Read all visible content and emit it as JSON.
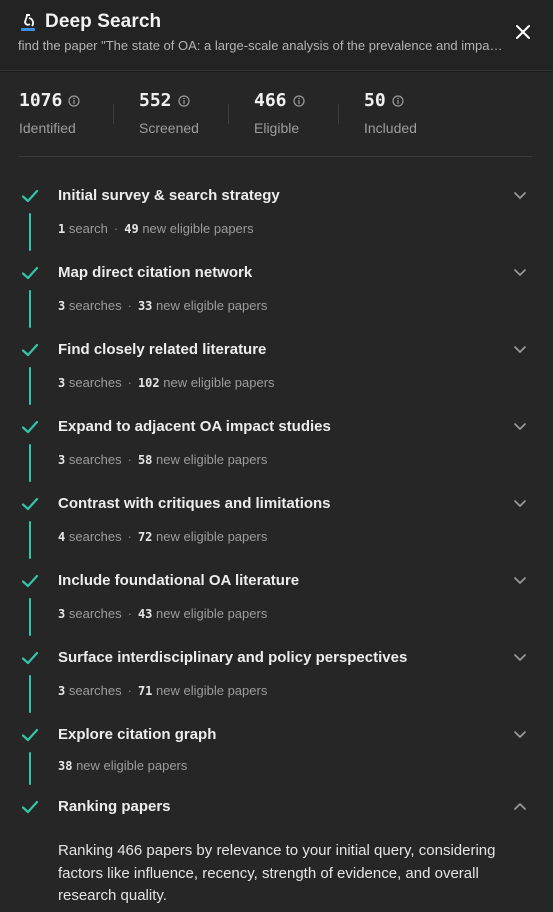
{
  "header": {
    "title": "Deep Search",
    "subtitle": "find the paper \"The state of OA: a large-scale analysis of the prevalence and impact of Open Access articles\""
  },
  "stats": [
    {
      "value": "1076",
      "label": "Identified"
    },
    {
      "value": "552",
      "label": "Screened"
    },
    {
      "value": "466",
      "label": "Eligible"
    },
    {
      "value": "50",
      "label": "Included"
    }
  ],
  "steps": [
    {
      "title": "Initial survey & search strategy",
      "searches": "1",
      "searches_word": "search",
      "papers": "49",
      "papers_label": "new eligible papers"
    },
    {
      "title": "Map direct citation network",
      "searches": "3",
      "searches_word": "searches",
      "papers": "33",
      "papers_label": "new eligible papers"
    },
    {
      "title": "Find closely related literature",
      "searches": "3",
      "searches_word": "searches",
      "papers": "102",
      "papers_label": "new eligible papers"
    },
    {
      "title": "Expand to adjacent OA impact studies",
      "searches": "3",
      "searches_word": "searches",
      "papers": "58",
      "papers_label": "new eligible papers"
    },
    {
      "title": "Contrast with critiques and limitations",
      "searches": "4",
      "searches_word": "searches",
      "papers": "72",
      "papers_label": "new eligible papers"
    },
    {
      "title": "Include foundational OA literature",
      "searches": "3",
      "searches_word": "searches",
      "papers": "43",
      "papers_label": "new eligible papers"
    },
    {
      "title": "Surface interdisciplinary and policy perspectives",
      "searches": "3",
      "searches_word": "searches",
      "papers": "71",
      "papers_label": "new eligible papers"
    },
    {
      "title": "Explore citation graph",
      "papers": "38",
      "papers_label": "new eligible papers"
    }
  ],
  "ranking": {
    "title": "Ranking papers",
    "description": "Ranking 466 papers by relevance to your initial query, considering factors like influence, recency, strength of evidence, and overall research quality."
  },
  "colors": {
    "accent": "#33c6a6",
    "background": "#262627",
    "header": "#232324"
  },
  "icons": {
    "title": "microscope-icon",
    "close": "close-icon",
    "info": "info-icon",
    "check": "check-icon",
    "expand": "chevron-down-icon",
    "collapse": "chevron-up-icon"
  }
}
